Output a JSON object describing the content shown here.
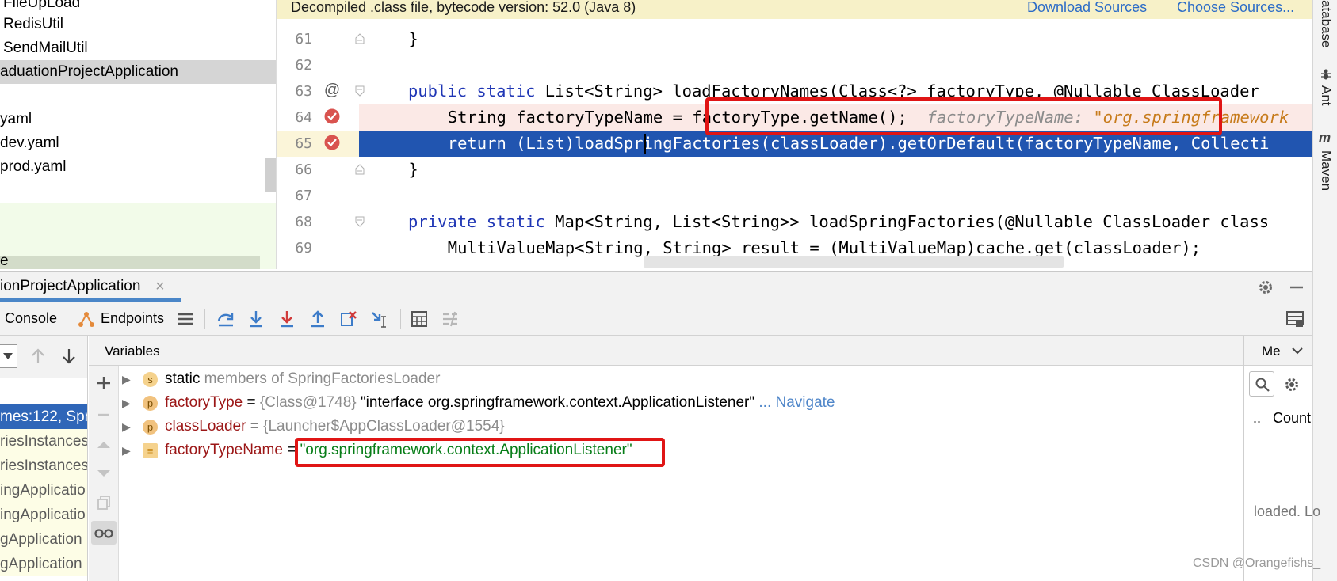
{
  "project_tree": {
    "items": [
      {
        "label": "FileUpLoad",
        "selected": false
      },
      {
        "label": "RedisUtil",
        "selected": false
      },
      {
        "label": "SendMailUtil",
        "selected": false
      },
      {
        "label": "aduationProjectApplication",
        "selected": true
      },
      {
        "label": "yaml",
        "selected": false
      },
      {
        "label": "dev.yaml",
        "selected": false
      },
      {
        "label": "prod.yaml",
        "selected": false
      }
    ],
    "scroll_label": "e"
  },
  "editor": {
    "banner": {
      "message": "Decompiled .class file, bytecode version: 52.0 (Java 8)",
      "download_sources": "Download Sources",
      "choose_sources": "Choose Sources..."
    },
    "line_numbers": [
      "61",
      "62",
      "63",
      "64",
      "65",
      "66",
      "67",
      "68",
      "69"
    ],
    "lines": {
      "l61": "    }",
      "l62": "",
      "l63_kw1": "public",
      "l63_kw2": "static",
      "l63_rest": " List<String> loadFactoryNames(Class<?> factoryType, @Nullable ClassLoader",
      "l64_code": "        String factoryTypeName = factoryType.getName();",
      "l64_hint_label": "factoryTypeName: ",
      "l64_hint_value": "\"org.springframework",
      "l65": "        return (List)loadSpringFactories(classLoader).getOrDefault(factoryTypeName, Collecti",
      "l66": "    }",
      "l67": "",
      "l68_kw1": "private",
      "l68_kw2": "static",
      "l68_rest": " Map<String, List<String>> loadSpringFactories(@Nullable ClassLoader class",
      "l69": "        MultiValueMap<String, String> result = (MultiValueMap)cache.get(classLoader);"
    },
    "gutter_at": "@"
  },
  "right_strip": {
    "database": "atabase",
    "ant": "Ant",
    "maven": "Maven"
  },
  "debug": {
    "session_tab": "ionProjectApplication",
    "close_glyph": "×",
    "toolbar": {
      "console": "Console",
      "endpoints": "Endpoints"
    },
    "frames": [
      {
        "label": "mes:122, Spri",
        "selected": true
      },
      {
        "label": "riesInstances",
        "selected": false
      },
      {
        "label": "riesInstances",
        "selected": false
      },
      {
        "label": "ingApplicatio",
        "selected": false
      },
      {
        "label": "ingApplicatio",
        "selected": false
      },
      {
        "label": "gApplication",
        "selected": false
      },
      {
        "label": "gApplication",
        "selected": false
      }
    ],
    "variables_header": "Variables",
    "variables": [
      {
        "badge": "s",
        "name": "static",
        "detail": " members of SpringFactoriesLoader"
      },
      {
        "badge": "p",
        "name": "factoryType",
        "eq": " = ",
        "type": "{Class@1748} ",
        "value": "\"interface org.springframework.context.ApplicationListener\"",
        "link": " ... Navigate"
      },
      {
        "badge": "p",
        "name": "classLoader",
        "eq": " = ",
        "type": "{Launcher$AppClassLoader@1554}"
      },
      {
        "badge": "≡",
        "name": "factoryTypeName",
        "eq": " = ",
        "value": "\"org.springframework.context.ApplicationListener\""
      }
    ],
    "memory": {
      "tab": "Me",
      "count": "Count",
      "dots": "..",
      "loaded": "loaded. Lo"
    }
  },
  "watermark": "CSDN @Orangefishs_",
  "colors": {
    "keyword": "#1f36b5",
    "exec_line": "#2155b0",
    "breakpoint_line": "#fbe9e6",
    "highlight_box": "#e01515",
    "string_value": "#067d17",
    "var_name": "#871094"
  }
}
